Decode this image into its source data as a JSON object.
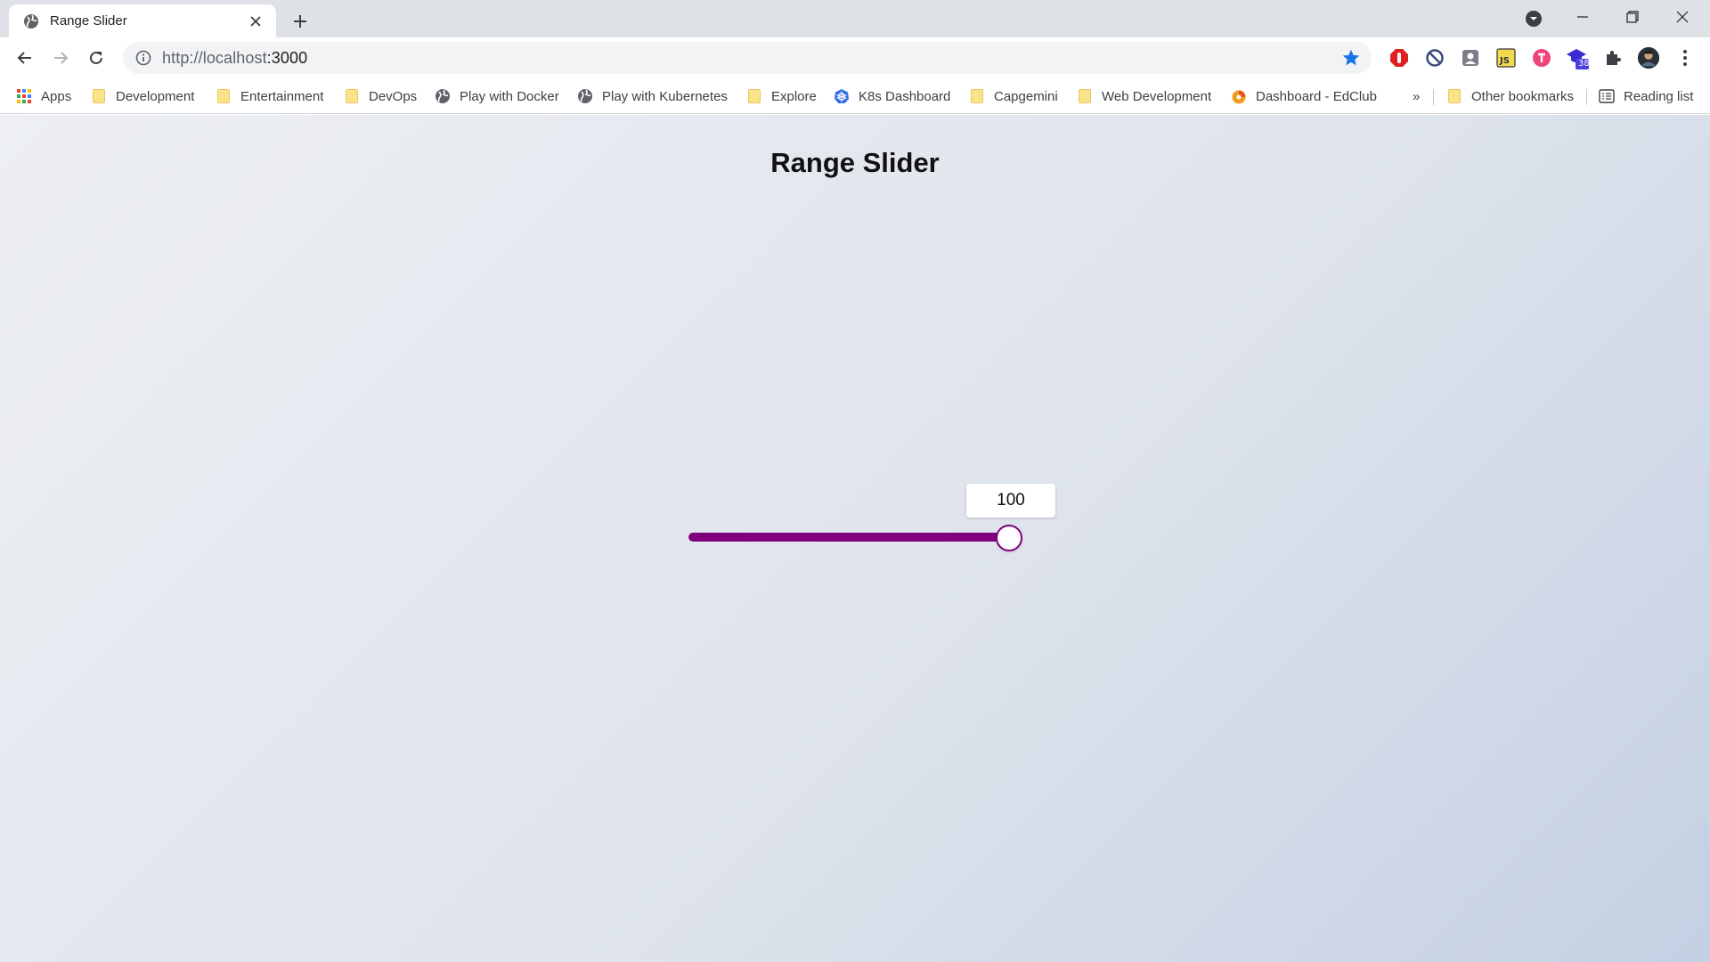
{
  "browser": {
    "tab_title": "Range Slider",
    "url_host": "http://localhost",
    "url_port": ":3000",
    "extension_badge": "38"
  },
  "bookmarks": [
    {
      "label": "Apps",
      "icon": "apps-grid-icon"
    },
    {
      "label": "Development",
      "icon": "folder-icon"
    },
    {
      "label": "Entertainment",
      "icon": "folder-icon"
    },
    {
      "label": "DevOps",
      "icon": "folder-icon"
    },
    {
      "label": "Play with Docker",
      "icon": "globe-icon"
    },
    {
      "label": "Play with Kubernetes",
      "icon": "globe-icon"
    },
    {
      "label": "Explore",
      "icon": "folder-icon"
    },
    {
      "label": "K8s Dashboard",
      "icon": "kubernetes-icon"
    },
    {
      "label": "Capgemini",
      "icon": "folder-icon"
    },
    {
      "label": "Web Development",
      "icon": "folder-icon"
    },
    {
      "label": "Dashboard - EdClub",
      "icon": "edclub-icon"
    }
  ],
  "bookmarks_overflow": "»",
  "other_bookmarks": "Other bookmarks",
  "reading_list": "Reading list",
  "page": {
    "title": "Range Slider",
    "slider": {
      "value": 100,
      "min": 0,
      "max": 100,
      "value_label": "100",
      "track_color": "#d3d3d3",
      "fill_color": "#800080"
    }
  }
}
